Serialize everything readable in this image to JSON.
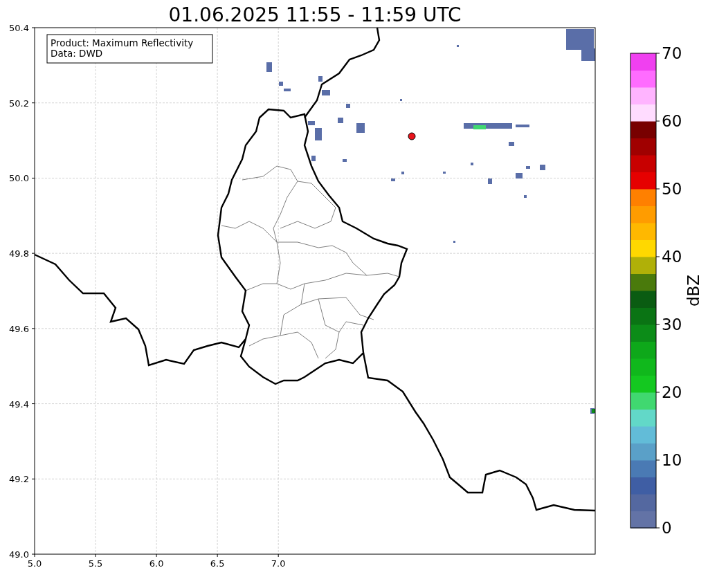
{
  "title": "01.06.2025 11:55 - 11:59 UTC",
  "info_box": [
    "Product: Maximum Reflectivity",
    "Data: DWD"
  ],
  "map": {
    "xticks": [
      "5.0",
      "5.5",
      "6.0",
      "6.5",
      "7.0"
    ],
    "yticks": [
      "50.4",
      "50.2",
      "50.0",
      "49.8",
      "49.6",
      "49.4",
      "49.2",
      "49.0"
    ]
  },
  "colorbar": {
    "label": "dBZ",
    "ticks": [
      "70",
      "60",
      "50",
      "40",
      "30",
      "20",
      "10",
      "0"
    ],
    "bands": [
      {
        "color": "#6373a6"
      },
      {
        "color": "#5468a0"
      },
      {
        "color": "#3f5ea4"
      },
      {
        "color": "#4a7ab4"
      },
      {
        "color": "#5aa0c8"
      },
      {
        "color": "#62bcd8"
      },
      {
        "color": "#62d8c8"
      },
      {
        "color": "#40d870"
      },
      {
        "color": "#14c820"
      },
      {
        "color": "#10b81c"
      },
      {
        "color": "#0ea81a"
      },
      {
        "color": "#0c8c18"
      },
      {
        "color": "#0a7414"
      },
      {
        "color": "#0a5c12"
      },
      {
        "color": "#4a7a0c"
      },
      {
        "color": "#b0b008"
      },
      {
        "color": "#ffd800"
      },
      {
        "color": "#ffb800"
      },
      {
        "color": "#ff9c00"
      },
      {
        "color": "#ff8000"
      },
      {
        "color": "#e60000"
      },
      {
        "color": "#c80000"
      },
      {
        "color": "#a00000"
      },
      {
        "color": "#780000"
      },
      {
        "color": "#ffdcff"
      },
      {
        "color": "#ffb4ff"
      },
      {
        "color": "#ff6cff"
      },
      {
        "color": "#f040f0"
      }
    ]
  }
}
